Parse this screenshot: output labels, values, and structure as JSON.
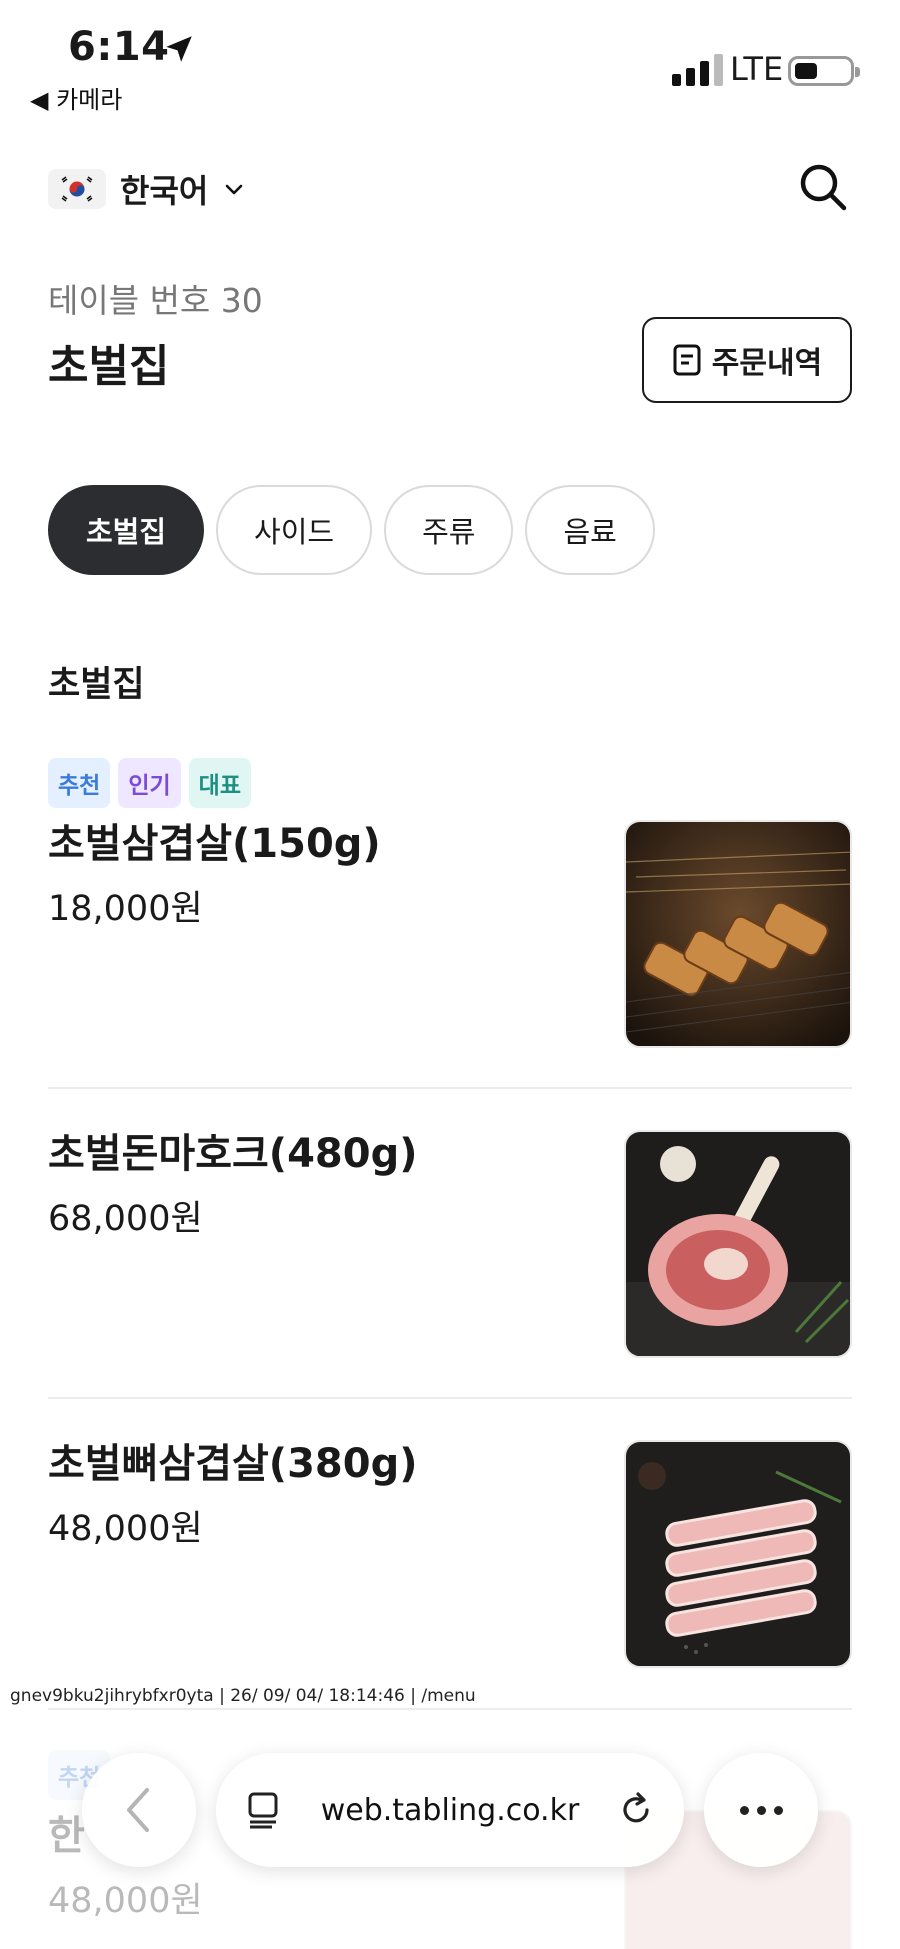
{
  "status_bar": {
    "time": "6:14",
    "back_app": "◀ 카메라",
    "network": "LTE"
  },
  "language": {
    "label": "한국어",
    "flag_icon": "korea-flag-icon"
  },
  "header": {
    "table_number": "테이블 번호 30",
    "store_name": "초벌집",
    "order_history_label": "주문내역"
  },
  "tabs": [
    {
      "label": "초벌집",
      "active": true
    },
    {
      "label": "사이드",
      "active": false
    },
    {
      "label": "주류",
      "active": false
    },
    {
      "label": "음료",
      "active": false
    }
  ],
  "section": {
    "title": "초벌집"
  },
  "menu_items": [
    {
      "badges": [
        "추천",
        "인기",
        "대표"
      ],
      "name": "초벌삼겹살(150g)",
      "price": "18,000원"
    },
    {
      "badges": [],
      "name": "초벌돈마호크(480g)",
      "price": "68,000원"
    },
    {
      "badges": [],
      "name": "초벌뼈삼겹살(380g)",
      "price": "48,000원"
    },
    {
      "badges": [
        "추천"
      ],
      "name": "한",
      "price": "48,000원"
    }
  ],
  "debug_line": "gnev9bku2jihrybfxr0yta | 26/ 09/ 04/ 18:14:46 | /menu",
  "browser": {
    "url": "web.tabling.co.kr"
  },
  "colors": {
    "active_tab": "#2b2d31",
    "badge_blue": "#3a7bdc",
    "badge_purple": "#7c4ad6",
    "badge_teal": "#1f8f84"
  }
}
